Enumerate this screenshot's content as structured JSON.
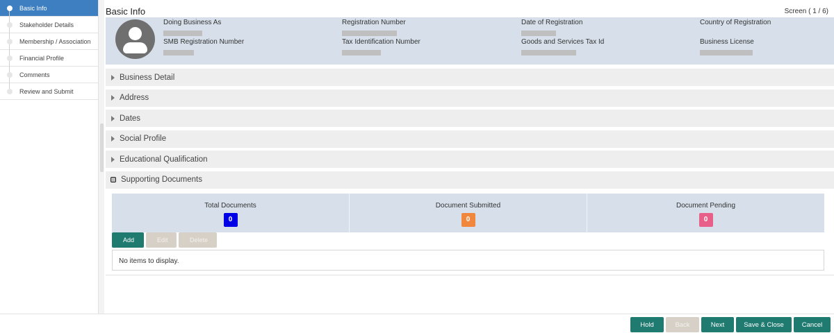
{
  "sidebar": {
    "steps": [
      {
        "label": "Basic Info"
      },
      {
        "label": "Stakeholder Details"
      },
      {
        "label": "Membership / Association"
      },
      {
        "label": "Financial Profile"
      },
      {
        "label": "Comments"
      },
      {
        "label": "Review and Submit"
      }
    ]
  },
  "header": {
    "title": "Basic Info",
    "screen": "Screen ( 1 / 6)"
  },
  "profile": {
    "fields": {
      "dba": "Doing Business As",
      "registration_number": "Registration Number",
      "date_of_registration": "Date of Registration",
      "country_of_registration": "Country of Registration",
      "smb_registration_number": "SMB Registration Number",
      "tax_id": "Tax Identification Number",
      "gst_id": "Goods and Services Tax Id",
      "business_license": "Business License"
    }
  },
  "sections": [
    {
      "label": "Business Detail",
      "expanded": false
    },
    {
      "label": "Address",
      "expanded": false
    },
    {
      "label": "Dates",
      "expanded": false
    },
    {
      "label": "Social Profile",
      "expanded": false
    },
    {
      "label": "Educational Qualification",
      "expanded": false
    },
    {
      "label": "Supporting Documents",
      "expanded": true
    }
  ],
  "documents": {
    "stats": [
      {
        "label": "Total Documents",
        "value": "0",
        "color": "#0000e6"
      },
      {
        "label": "Document Submitted",
        "value": "0",
        "color": "#f0873c"
      },
      {
        "label": "Document Pending",
        "value": "0",
        "color": "#e8608a"
      }
    ],
    "add_label": "Add",
    "edit_label": "Edit",
    "delete_label": "Delete",
    "empty_text": "No items to display."
  },
  "footer": {
    "hold": "Hold",
    "back": "Back",
    "next": "Next",
    "save_close": "Save & Close",
    "cancel": "Cancel"
  },
  "colors": {
    "accent": "#1f7a70",
    "active_step": "#3d7fc1",
    "disabled": "#d7d0c6",
    "cancel": "#1f7a70"
  }
}
